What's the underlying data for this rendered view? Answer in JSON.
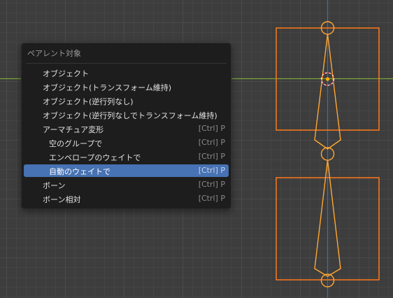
{
  "viewport": {
    "colors": {
      "background": "#3d3d3d",
      "grid": "#4a4a4a",
      "x_axis": "#7ea33a",
      "z_axis": "#2f6fc8",
      "bone_selected": "#ff8c00",
      "bone_outline": "#ffa733",
      "object_origin": "#ff3333"
    }
  },
  "menu": {
    "title": "ペアレント対象",
    "items": [
      {
        "label": "オブジェクト",
        "shortcut": "",
        "indent": 0,
        "active": false
      },
      {
        "label": "オブジェクト(トランスフォーム維持)",
        "shortcut": "",
        "indent": 0,
        "active": false
      },
      {
        "label": "オブジェクト(逆行列なし)",
        "shortcut": "",
        "indent": 0,
        "active": false
      },
      {
        "label": "オブジェクト(逆行列なしでトランスフォーム維持)",
        "shortcut": "",
        "indent": 0,
        "active": false
      },
      {
        "label": "アーマチュア変形",
        "shortcut": "[Ctrl] P",
        "indent": 0,
        "active": false
      },
      {
        "label": "空のグループで",
        "shortcut": "[Ctrl] P",
        "indent": 1,
        "active": false
      },
      {
        "label": "エンベロープのウェイトで",
        "shortcut": "[Ctrl] P",
        "indent": 1,
        "active": false
      },
      {
        "label": "自動のウェイトで",
        "shortcut": "[Ctrl] P",
        "indent": 1,
        "active": true
      },
      {
        "label": "ボーン",
        "shortcut": "[Ctrl] P",
        "indent": 0,
        "active": false
      },
      {
        "label": "ボーン相対",
        "shortcut": "[Ctrl] P",
        "indent": 0,
        "active": false
      }
    ],
    "accent_color": "#4772b3"
  }
}
